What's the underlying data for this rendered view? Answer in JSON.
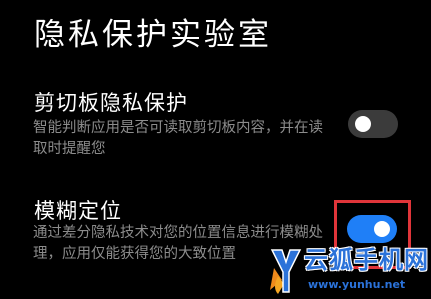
{
  "page": {
    "title": "隐私保护实验室"
  },
  "settings": [
    {
      "title": "剪切板隐私保护",
      "description": "智能判断应用是否可读取剪切板内容，并在读取时提醒您",
      "enabled": false
    },
    {
      "title": "模糊定位",
      "description": "通过差分隐私技术对您的位置信息进行模糊处理，应用仅能获得您的大致位置",
      "enabled": true
    }
  ],
  "watermark": {
    "logo_letter": "Y",
    "name": "云狐手机网",
    "url": "www.yunhu.net"
  },
  "colors": {
    "background": "#000000",
    "toggle_on": "#1f7ff7",
    "toggle_off": "#3b3b3b",
    "description_text": "#8c8c8c",
    "highlight_box": "#e0353a",
    "watermark_blue": "#2b72d9",
    "watermark_orange": "#f08a1c"
  },
  "icons": {
    "toggle_knob": "circle-knob-icon",
    "watermark_logo": "fox-y-logo-icon"
  }
}
